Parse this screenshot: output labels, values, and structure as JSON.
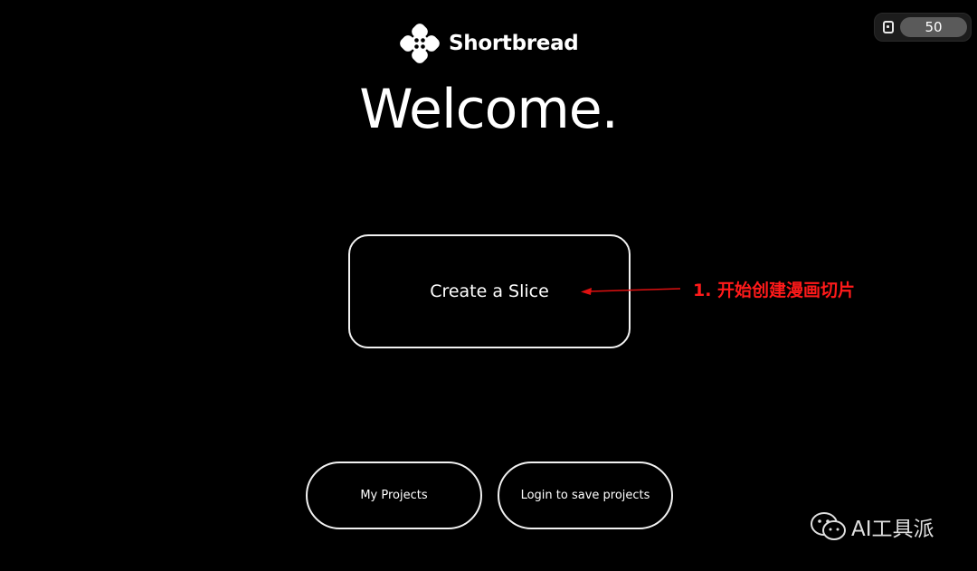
{
  "header": {
    "brand_name": "Shortbread",
    "logo_icon": "shortbread-logo-icon",
    "credits": {
      "icon": "bread-slice-icon",
      "count": "50"
    }
  },
  "main": {
    "heading": "Welcome.",
    "create_slice_label": "Create a Slice"
  },
  "annotation": {
    "text": "1. 开始创建漫画切片",
    "color": "#ff1a1a"
  },
  "footer": {
    "my_projects_label": "My Projects",
    "login_save_label": "Login to save projects"
  },
  "watermark": {
    "icon": "wechat-icon",
    "text": "AI工具派"
  },
  "colors": {
    "background": "#000000",
    "foreground": "#ffffff",
    "badge_pill": "#5a5a5a"
  }
}
